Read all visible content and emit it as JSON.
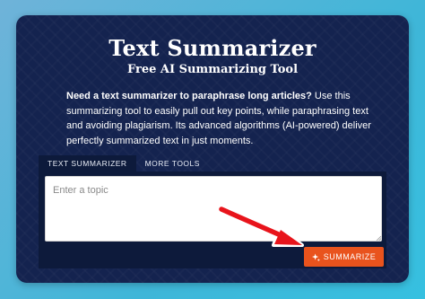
{
  "header": {
    "title": "Text Summarizer",
    "subtitle": "Free AI Summarizing Tool"
  },
  "description": {
    "lead": "Need a text summarizer to paraphrase long articles?",
    "body": " Use this summarizing tool to easily pull out key points, while paraphrasing text and avoiding plagiarism. Its advanced algorithms (AI-powered) deliver perfectly summarized text in just moments."
  },
  "tabs": [
    {
      "label": "TEXT SUMMARIZER",
      "active": true
    },
    {
      "label": "MORE TOOLS",
      "active": false
    }
  ],
  "input": {
    "placeholder": "Enter a topic",
    "value": ""
  },
  "summarize_button": {
    "label": "SUMMARIZE",
    "icon": "sparkle-icon"
  },
  "annotation": {
    "icon": "red-arrow-icon",
    "color": "#e8141b"
  },
  "colors": {
    "card_background": "#14234f",
    "panel_background": "#0d1a3b",
    "button_accent": "#e9531d",
    "page_background": "#3fb6d8"
  }
}
